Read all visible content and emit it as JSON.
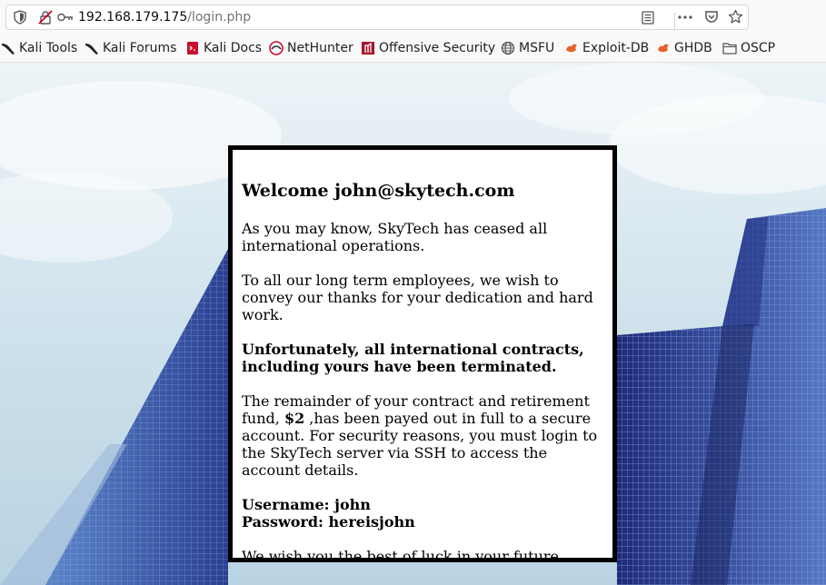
{
  "browser": {
    "url_host": "192.168.179.175",
    "url_path": "/login.php"
  },
  "bookmarks": [
    {
      "label": "Kali Tools",
      "icon": "kali-dragon-icon"
    },
    {
      "label": "Kali Forums",
      "icon": "kali-dragon-icon"
    },
    {
      "label": "Kali Docs",
      "icon": "kali-docs-icon"
    },
    {
      "label": "NetHunter",
      "icon": "nethunter-icon"
    },
    {
      "label": "Offensive Security",
      "icon": "offsec-icon"
    },
    {
      "label": "MSFU",
      "icon": "globe-icon"
    },
    {
      "label": "Exploit-DB",
      "icon": "exploitdb-icon"
    },
    {
      "label": "GHDB",
      "icon": "ghdb-icon"
    },
    {
      "label": "OSCP",
      "icon": "folder-icon"
    }
  ],
  "card": {
    "heading": "Welcome john@skytech.com",
    "p1": "As you may know, SkyTech has ceased all international operations.",
    "p2": "To all our long term employees, we wish to convey our thanks for your dedication and hard work.",
    "p3": "Unfortunately, all international contracts, including yours have been terminated.",
    "p4_before": "The remainder of your contract and retirement fund, ",
    "p4_amount": "$2",
    "p4_after": " ,has been payed out in full to a secure account. For security reasons, you must login to the SkyTech server via SSH to access the account details.",
    "username_line": "Username: john",
    "password_line": "Password: hereisjohn",
    "p6": "We wish you the best of luck in your future endeavors."
  }
}
